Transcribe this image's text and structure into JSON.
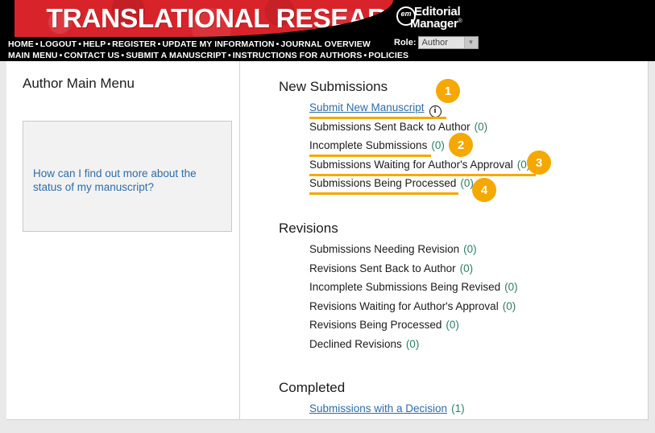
{
  "header": {
    "journal_title": "TRANSLATIONAL RESEARCH",
    "logo": {
      "mark": "em",
      "line1": "Editorial",
      "line2": "Manager",
      "registered": "®"
    },
    "role_label": "Role:",
    "role_value": "Author",
    "nav_row1": [
      "HOME",
      "LOGOUT",
      "HELP",
      "REGISTER",
      "UPDATE MY INFORMATION",
      "JOURNAL OVERVIEW"
    ],
    "nav_row2": [
      "MAIN MENU",
      "CONTACT US",
      "SUBMIT A MANUSCRIPT",
      "INSTRUCTIONS FOR AUTHORS",
      "POLICIES"
    ],
    "nav_separator": "•"
  },
  "sidebar": {
    "title": "Author Main Menu",
    "help_link": "How can I find out more about the status of my manuscript?"
  },
  "main": {
    "sections": [
      {
        "title": "New Submissions",
        "items": [
          {
            "label": "Submit New Manuscript",
            "count": "",
            "link": true,
            "info_icon": true,
            "underlined": true
          },
          {
            "label": "Submissions Sent Back to Author",
            "count": "(0)",
            "link": false,
            "info_icon": false,
            "underlined": false
          },
          {
            "label": "Incomplete Submissions",
            "count": "(0)",
            "link": false,
            "info_icon": false,
            "underlined": true
          },
          {
            "label": "Submissions Waiting for Author's Approval",
            "count": "(0)",
            "link": false,
            "info_icon": false,
            "underlined": true
          },
          {
            "label": "Submissions Being Processed",
            "count": "(0)",
            "link": false,
            "info_icon": false,
            "underlined": true
          }
        ]
      },
      {
        "title": "Revisions",
        "items": [
          {
            "label": "Submissions Needing Revision",
            "count": "(0)",
            "link": false,
            "info_icon": false,
            "underlined": false
          },
          {
            "label": "Revisions Sent Back to Author",
            "count": "(0)",
            "link": false,
            "info_icon": false,
            "underlined": false
          },
          {
            "label": "Incomplete Submissions Being Revised",
            "count": "(0)",
            "link": false,
            "info_icon": false,
            "underlined": false
          },
          {
            "label": "Revisions Waiting for Author's Approval",
            "count": "(0)",
            "link": false,
            "info_icon": false,
            "underlined": false
          },
          {
            "label": "Revisions Being Processed",
            "count": "(0)",
            "link": false,
            "info_icon": false,
            "underlined": false
          },
          {
            "label": "Declined Revisions",
            "count": "(0)",
            "link": false,
            "info_icon": false,
            "underlined": false
          }
        ]
      },
      {
        "title": "Completed",
        "items": [
          {
            "label": "Submissions with a Decision",
            "count": "(1)",
            "link": true,
            "info_icon": false,
            "underlined": false
          }
        ]
      }
    ],
    "info_icon_glyph": "i"
  },
  "annotations": {
    "badges": [
      {
        "number": "1"
      },
      {
        "number": "2"
      },
      {
        "number": "3"
      },
      {
        "number": "4"
      }
    ],
    "highlight_color": "#f5a800"
  }
}
